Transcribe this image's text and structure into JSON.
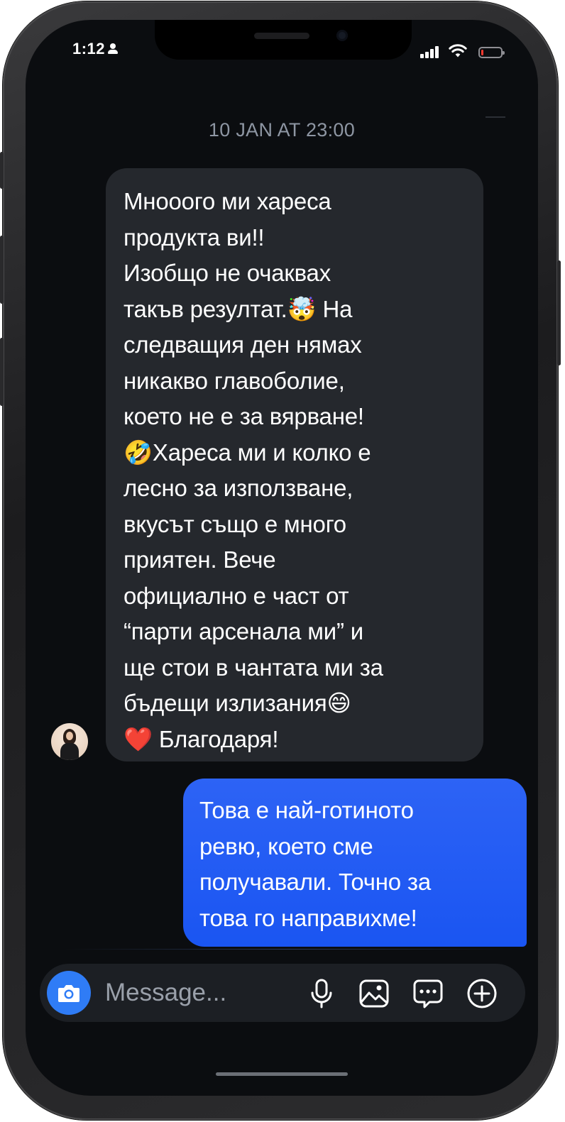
{
  "status_bar": {
    "time": "1:12",
    "person_icon": "person-icon",
    "signal_icon": "cellular-signal-icon",
    "wifi_icon": "wifi-icon",
    "battery_icon": "battery-icon",
    "battery_level": 0.12,
    "battery_color": "#ff3b30"
  },
  "conversation": {
    "timestamp": "10 JAN AT 23:00",
    "messages": [
      {
        "direction": "incoming",
        "text": "Мнооого ми хареса\nпродукта ви!!\nИзобщо не очаквах\nтакъв резултат.🤯 На\nследващия ден нямах\nникакво главоболие,\nкоето не е за вярване!\n🤣Хареса ми и колко е\nлесно за използване,\nвкусът също е много\nприятен. Вече\nофициално е част от\n“парти арсенала ми” и\nще стои в чантата ми за\nбъдещи излизания😄\n❤️ Благодаря!",
        "bubble_color": "#25282d"
      },
      {
        "direction": "outgoing",
        "text": "Това е най-готиното\nревю, което сме\nполучавали. Точно за\nтова го направихме!",
        "bubble_color": "#1a55f2"
      }
    ]
  },
  "composer": {
    "placeholder": "Message...",
    "value": "",
    "camera_icon": "camera-icon",
    "mic_icon": "microphone-icon",
    "gallery_icon": "gallery-icon",
    "sticker_icon": "sticker-icon",
    "plus_icon": "plus-icon",
    "camera_button_color": "#2f7cf6"
  }
}
